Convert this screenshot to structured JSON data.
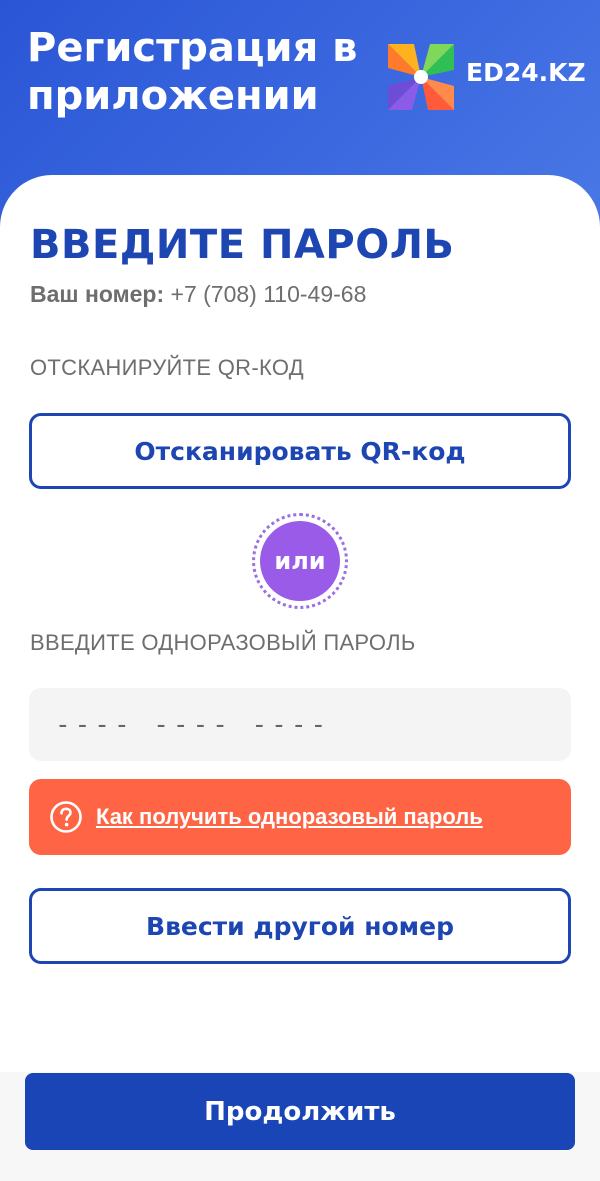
{
  "header": {
    "title": "Регистрация в приложении",
    "brand": "ED24.KZ"
  },
  "main": {
    "title": "ВВЕДИТЕ ПАРОЛЬ",
    "phone_label": "Ваш номер:",
    "phone_value": "+7 (708) 110-49-68",
    "qr_section_label": "ОТСКАНИРУЙТЕ QR-КОД",
    "qr_button": "Отсканировать QR-код",
    "or_label": "или",
    "otp_section_label": "ВВЕДИТЕ ОДНОРАЗОВЫЙ ПАРОЛЬ",
    "otp_placeholder": "---- ---- ----",
    "help_link": "Как получить одноразовый пароль",
    "other_number_button": "Ввести другой номер",
    "continue_button": "Продолжить"
  },
  "colors": {
    "primary": "#1d46b2",
    "header_bg": "#3d6ae0",
    "accent_orange": "#ff6444",
    "accent_purple": "#9a5ce8"
  },
  "icons": {
    "logo": "pinwheel-logo-icon",
    "help": "question-circle-icon"
  }
}
